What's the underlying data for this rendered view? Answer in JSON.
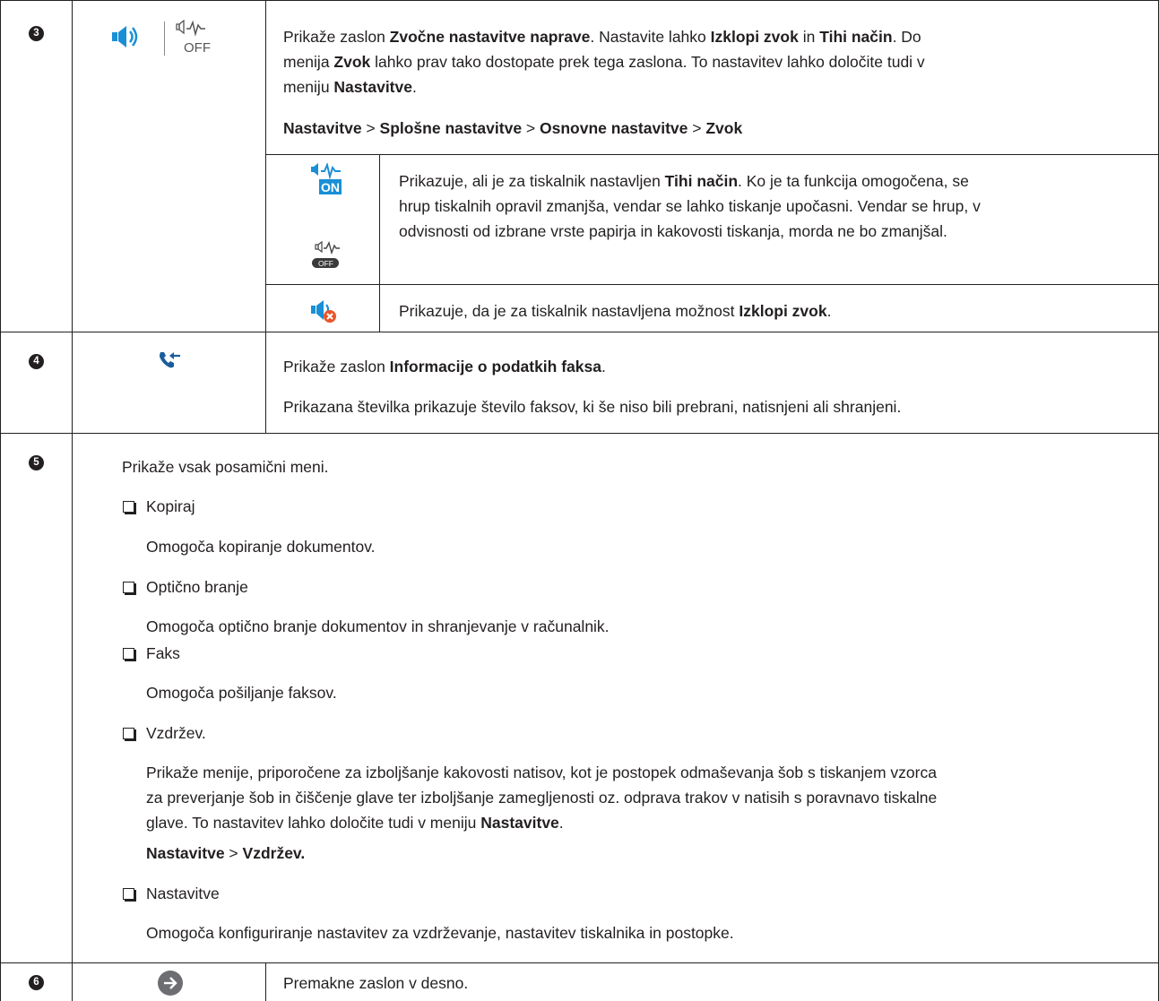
{
  "rows": {
    "r3": {
      "num": "3",
      "off_icon_text": "OFF",
      "p1": [
        "Prikaže zaslon ",
        "Zvočne nastavitve naprave",
        ". Nastavite lahko ",
        "Izklopi zvok",
        " in ",
        "Tihi način",
        ". Do"
      ],
      "p1_l2": [
        "menija ",
        "Zvok",
        " lahko prav tako dostopate prek tega zaslona. To nastavitev lahko določite tudi v"
      ],
      "p1_l3": [
        "meniju ",
        "Nastavitve",
        "."
      ],
      "path": [
        "Nastavitve",
        " > ",
        "Splošne nastavitve",
        " > ",
        "Osnovne nastavitve",
        " > ",
        "Zvok"
      ],
      "sub1": {
        "on_icon_text": "ON",
        "off_icon_text": "OFF",
        "l1": [
          "Prikazuje, ali je za tiskalnik nastavljen ",
          "Tihi način",
          ". Ko je ta funkcija omogočena, se"
        ],
        "l2": "hrup tiskalnih opravil zmanjša, vendar se lahko tiskanje upočasni. Vendar se hrup, v",
        "l3": "odvisnosti od izbrane vrste papirja in kakovosti tiskanja, morda ne bo zmanjšal."
      },
      "sub2": [
        "Prikazuje, da je za tiskalnik nastavljena možnost ",
        "Izklopi zvok",
        "."
      ]
    },
    "r4": {
      "num": "4",
      "p1": [
        "Prikaže zaslon ",
        "Informacije o podatkih faksa",
        "."
      ],
      "p2": "Prikazana številka prikazuje število faksov, ki še niso bili prebrani, natisnjeni ali shranjeni."
    },
    "r5": {
      "num": "5",
      "intro": "Prikaže vsak posamični meni.",
      "items": [
        {
          "label": "Kopiraj",
          "desc": "Omogoča kopiranje dokumentov."
        },
        {
          "label": "Optično branje",
          "desc": "Omogoča optično branje dokumentov in shranjevanje v računalnik."
        },
        {
          "label": "Faks",
          "desc": "Omogoča pošiljanje faksov."
        },
        {
          "label": "Vzdržev.",
          "d1": "Prikaže menije, priporočene za izboljšanje kakovosti natisov, kot je postopek odmaševanja šob s tiskanjem vzorca",
          "d2": "za preverjanje šob in čiščenje glave ter izboljšanje zamegljenosti oz. odprava trakov v natisih s poravnavo tiskalne",
          "d3": [
            "glave. To nastavitev lahko določite tudi v meniju ",
            "Nastavitve",
            "."
          ],
          "path": [
            "Nastavitve",
            " > ",
            "Vzdržev."
          ]
        },
        {
          "label": "Nastavitve",
          "desc": "Omogoča konfiguriranje nastavitev za vzdrževanje, nastavitev tiskalnika in postopke."
        }
      ]
    },
    "r6": {
      "num": "6",
      "text": "Premakne zaslon v desno."
    }
  },
  "colors": {
    "text": "#231f20",
    "accent_blue": "#1a8fd6",
    "error_orange": "#e8542a",
    "arrow_gray": "#6d6e71"
  }
}
